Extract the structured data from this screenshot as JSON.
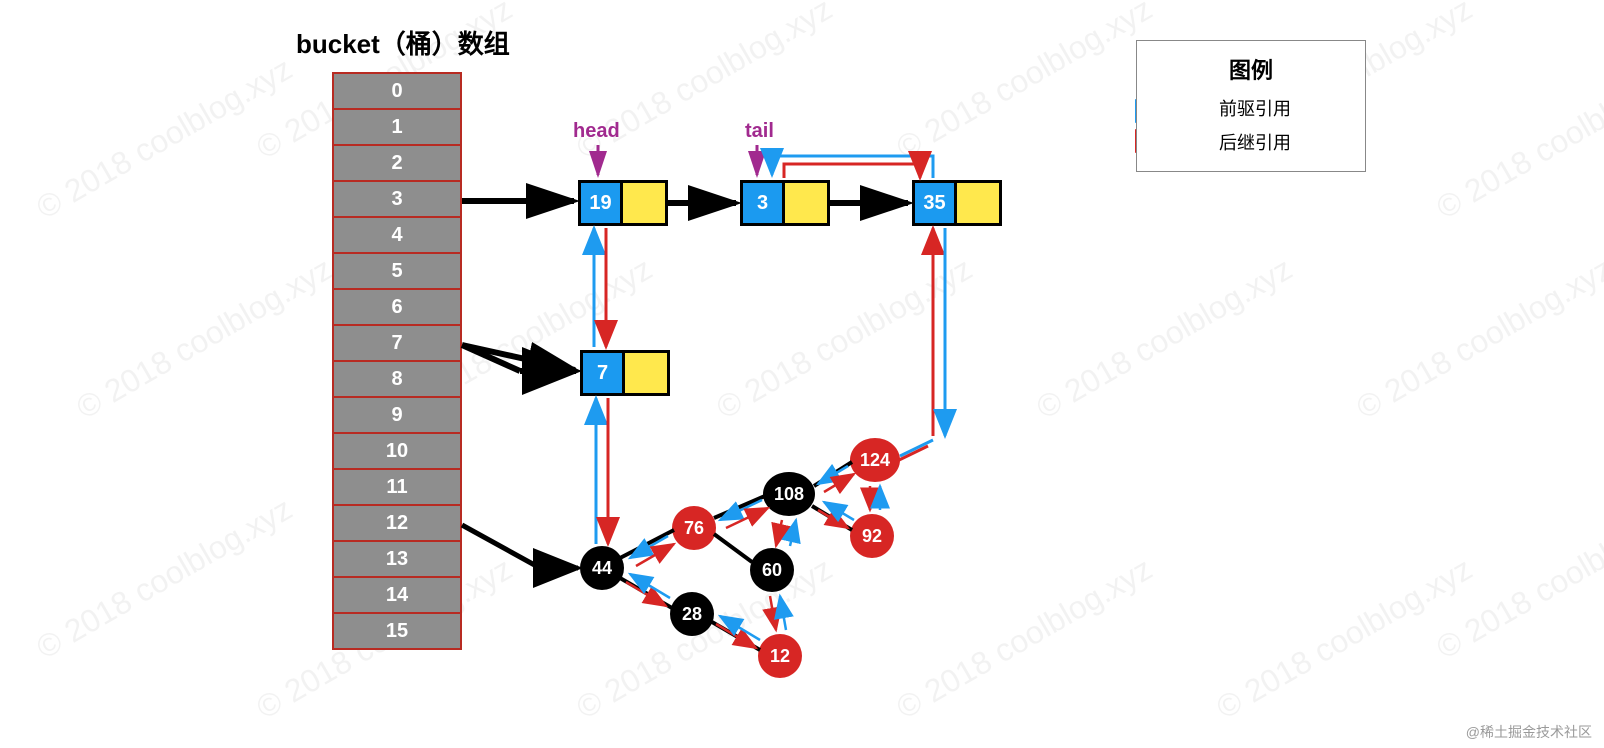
{
  "title": "bucket（桶）数组",
  "buckets": [
    "0",
    "1",
    "2",
    "3",
    "4",
    "5",
    "6",
    "7",
    "8",
    "9",
    "10",
    "11",
    "12",
    "13",
    "14",
    "15"
  ],
  "labels": {
    "head": "head",
    "tail": "tail"
  },
  "list_nodes": {
    "n19": "19",
    "n3": "3",
    "n35": "35",
    "n7": "7"
  },
  "tree_nodes": {
    "n44": "44",
    "n76": "76",
    "n28": "28",
    "n60": "60",
    "n12": "12",
    "n108": "108",
    "n124": "124",
    "n92": "92"
  },
  "legend": {
    "title": "图例",
    "prev": "前驱引用",
    "next": "后继引用"
  },
  "watermark": "© 2018 coolblog.xyz",
  "attribution": "@稀土掘金技术社区"
}
